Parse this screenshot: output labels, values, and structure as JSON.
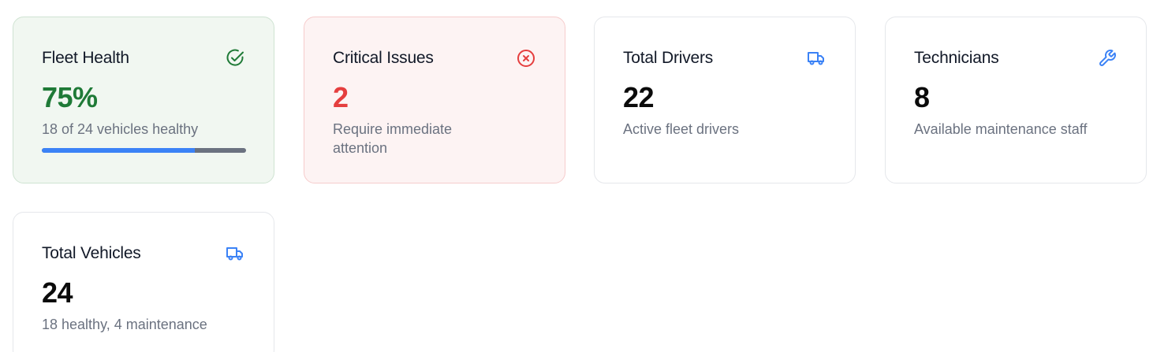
{
  "cards": [
    {
      "title": "Fleet Health",
      "value": "75%",
      "subtitle": "18 of 24 vehicles healthy",
      "progress": 0.75,
      "icon": "check-circle-icon",
      "color": "#1f7a37"
    },
    {
      "title": "Critical Issues",
      "value": "2",
      "subtitle": "Require immediate attention",
      "icon": "x-circle-icon",
      "color": "#e53e3e"
    },
    {
      "title": "Total Drivers",
      "value": "22",
      "subtitle": "Active fleet drivers",
      "icon": "truck-icon",
      "color": "#3b82f6"
    },
    {
      "title": "Technicians",
      "value": "8",
      "subtitle": "Available maintenance staff",
      "icon": "wrench-icon",
      "color": "#3b82f6"
    },
    {
      "title": "Total Vehicles",
      "value": "24",
      "subtitle": "18 healthy, 4 maintenance",
      "icon": "truck-icon",
      "color": "#3b82f6"
    }
  ]
}
